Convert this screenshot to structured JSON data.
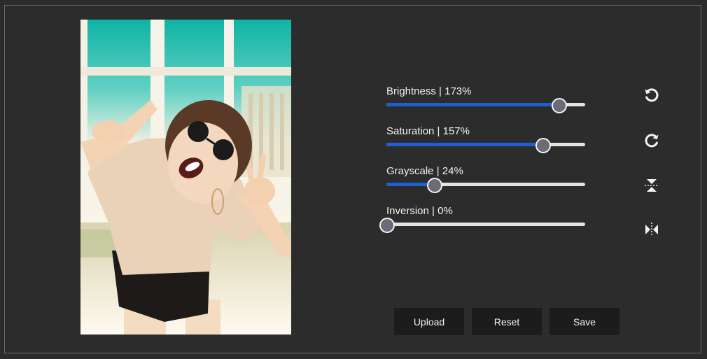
{
  "adjustments": [
    {
      "name": "Brightness",
      "label": "Brightness | 173%",
      "value": 173,
      "min": 0,
      "max": 200
    },
    {
      "name": "Saturation",
      "label": "Saturation | 157%",
      "value": 157,
      "min": 0,
      "max": 200
    },
    {
      "name": "Grayscale",
      "label": "Grayscale | 24%",
      "value": 24,
      "min": 0,
      "max": 100
    },
    {
      "name": "Inversion",
      "label": "Inversion | 0%",
      "value": 0,
      "min": 0,
      "max": 100
    }
  ],
  "tools": [
    {
      "icon": "rotate-left-icon"
    },
    {
      "icon": "rotate-right-icon"
    },
    {
      "icon": "flip-vertical-icon"
    },
    {
      "icon": "flip-horizontal-icon"
    }
  ],
  "buttons": {
    "upload": "Upload",
    "reset": "Reset",
    "save": "Save"
  },
  "colors": {
    "background": "#2b2b2b",
    "accent": "#1f5fd6",
    "track": "#e3e3e3",
    "button": "#1c1c1c"
  }
}
